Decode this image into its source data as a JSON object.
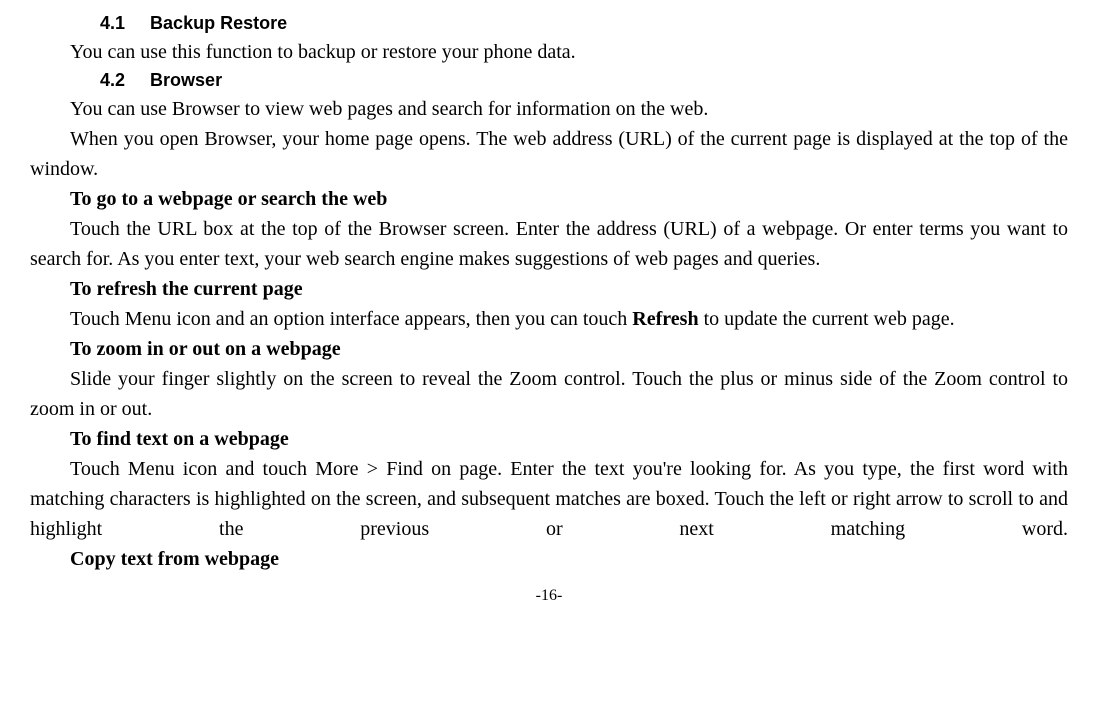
{
  "s41": {
    "num": "4.1",
    "title": "Backup Restore"
  },
  "p1": "You can use this function to backup or restore your phone data.",
  "s42": {
    "num": "4.2",
    "title": "Browser"
  },
  "p2": "You can use Browser to view web pages and search for information on the web.",
  "p3": "When you open Browser, your home page opens. The web address (URL) of the current page is displayed at the top of the window.",
  "h1": "To go to a webpage or search the web",
  "p4": "Touch the URL box at the top of the Browser screen. Enter the address (URL) of a webpage. Or enter terms you want to search for. As you enter text, your web search engine makes suggestions of web pages and queries.",
  "h2": "To refresh the current page",
  "p5a": "Touch Menu icon and an option interface appears, then you can touch ",
  "p5bold": "Refresh",
  "p5b": " to update the current web page.",
  "h3": "To zoom in or out on a webpage",
  "p6": "Slide your finger slightly on the screen to reveal the Zoom control. Touch the plus or minus side of the Zoom control to zoom in or out.",
  "h4": "To find text on a webpage",
  "p7": "Touch Menu icon and touch More > Find on page. Enter the text you're looking for. As you type, the first word with matching characters is highlighted on the screen, and subsequent matches are boxed. Touch the left or right arrow to scroll to and highlight the previous or next matching word.",
  "h5": "Copy text from webpage",
  "pagenum": "-16-"
}
